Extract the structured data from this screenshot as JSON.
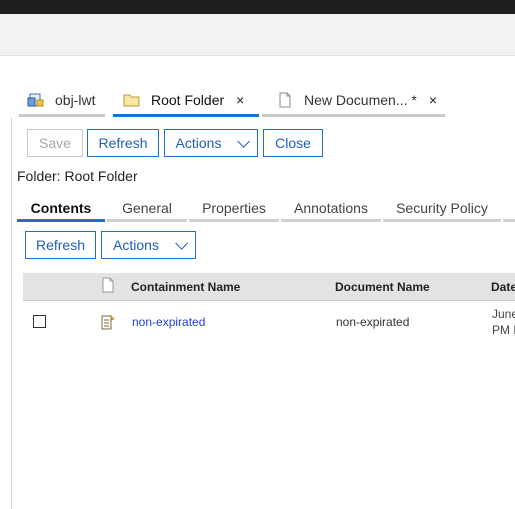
{
  "tabs": [
    {
      "label": "obj-lwt",
      "icon": "document-class-icon",
      "closable": false
    },
    {
      "label": "Root Folder",
      "icon": "folder-icon",
      "closable": true,
      "active": true
    },
    {
      "label": "New Documen... *",
      "icon": "document-icon",
      "closable": true
    }
  ],
  "close_glyph": "×",
  "toolbar": {
    "save": "Save",
    "refresh": "Refresh",
    "actions": "Actions",
    "close": "Close"
  },
  "folder_label": "Folder: Root Folder",
  "subtabs": [
    "Contents",
    "General",
    "Properties",
    "Annotations",
    "Security Policy"
  ],
  "contents_toolbar": {
    "refresh": "Refresh",
    "actions": "Actions"
  },
  "grid": {
    "columns": [
      "Containment Name",
      "Document Name",
      "Date"
    ],
    "rows": [
      {
        "containment_name": "non-expirated",
        "document_name": "non-expirated",
        "date_line1": "June",
        "date_line2": "PM F"
      }
    ]
  },
  "colors": {
    "accent": "#1f6fd0",
    "link": "#1f3fd0"
  }
}
